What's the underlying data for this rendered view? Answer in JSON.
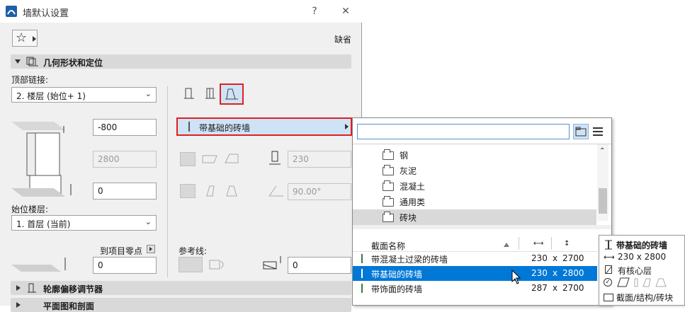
{
  "window": {
    "title": "墙默认设置",
    "help": "?",
    "close": "✕"
  },
  "favorites": {
    "star": "☆",
    "default_label": "缺省"
  },
  "sections": {
    "geometry": "几何形状和定位",
    "profile": "轮廓偏移调节器",
    "plan": "平面图和剖面"
  },
  "top_link": {
    "label": "顶部链接:",
    "value": "2. 楼层 (始位+ 1)"
  },
  "fields": {
    "top_offset": "-800",
    "height": "2800",
    "bottom_offset": "0",
    "thickness": "230",
    "angle": "90.00°",
    "ref_offset": "0",
    "project_zero": "0"
  },
  "home_story": {
    "label": "始位楼层:",
    "value": "1. 首层 (当前)"
  },
  "project_zero_label": "到项目零点",
  "ref_line_label": "参考线:",
  "building_material": {
    "value": "带基础的砖墙"
  },
  "popup": {
    "search_placeholder": "",
    "folders": [
      "钢",
      "灰泥",
      "混凝土",
      "通用类",
      "砖块"
    ],
    "selected_folder_index": 4,
    "list_header": {
      "name": "截面名称",
      "w_icon": "⟷",
      "h_icon": "↕"
    },
    "items": [
      {
        "name": "带混凝土过梁的砖墙",
        "w": "230",
        "x": "x",
        "h": "2700",
        "color": "#3a7a3a"
      },
      {
        "name": "带基础的砖墙",
        "w": "230",
        "x": "x",
        "h": "2800",
        "color": "#3a7a3a"
      },
      {
        "name": "带饰面的砖墙",
        "w": "287",
        "x": "x",
        "h": "2700",
        "color": "#3a7a3a"
      }
    ],
    "selected_item_index": 1
  },
  "tooltip": {
    "title": "带基础的砖墙",
    "size": "230 x 2800",
    "core": "有核心层",
    "path": "截面/结构/砖块"
  },
  "colors": {
    "highlight": "#0078d7",
    "red_box": "#e02020",
    "section_bg": "#d9d9d9"
  }
}
